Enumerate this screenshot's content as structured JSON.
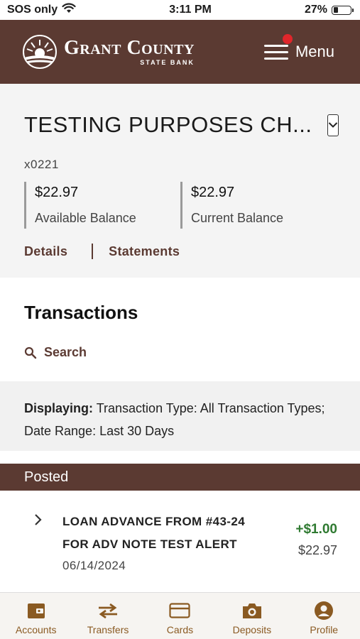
{
  "status_bar": {
    "carrier": "SOS only",
    "time": "3:11 PM",
    "battery": "27%",
    "battery_level": 0.27
  },
  "header": {
    "bank_name": "Grant County",
    "bank_sub": "STATE BANK",
    "menu_label": "Menu",
    "brand_color": "#5b3a32",
    "notification_color": "#e0262b"
  },
  "account": {
    "name": "TESTING PURPOSES CH...",
    "number": "x0221",
    "available_amount": "$22.97",
    "available_label": "Available Balance",
    "current_amount": "$22.97",
    "current_label": "Current Balance",
    "details_link": "Details",
    "statements_link": "Statements"
  },
  "transactions": {
    "heading": "Transactions",
    "search_label": "Search",
    "filter_prefix": "Displaying:",
    "filter_text": "Transaction Type: All Transaction Types; Date Range: Last 30 Days",
    "posted_label": "Posted",
    "items": [
      {
        "description_line1": "LOAN ADVANCE FROM #43-24",
        "description_line2": "FOR ADV NOTE TEST ALERT",
        "date": "06/14/2024",
        "amount": "+$1.00",
        "balance": "$22.97",
        "amount_color": "#2f7a31"
      }
    ]
  },
  "tab_bar": {
    "accent_color": "#8a5a22",
    "tabs": [
      {
        "label": "Accounts",
        "icon": "wallet-icon"
      },
      {
        "label": "Transfers",
        "icon": "transfer-arrows-icon"
      },
      {
        "label": "Cards",
        "icon": "credit-card-icon"
      },
      {
        "label": "Deposits",
        "icon": "camera-icon"
      },
      {
        "label": "Profile",
        "icon": "user-profile-icon"
      }
    ]
  }
}
